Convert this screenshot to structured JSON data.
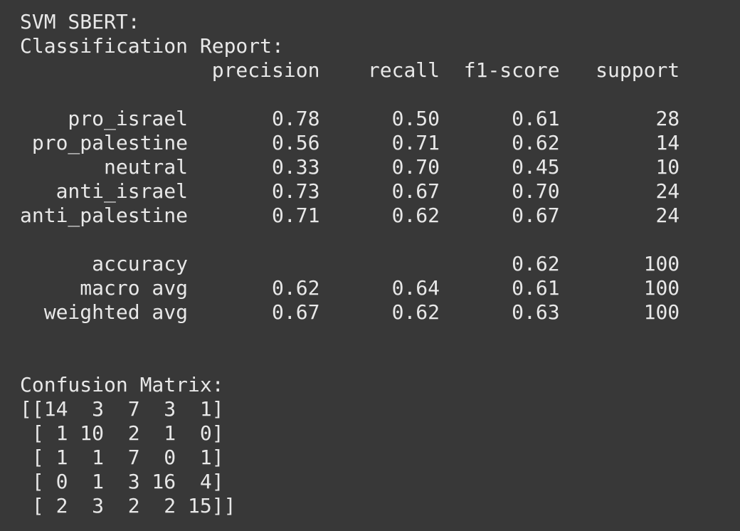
{
  "output": {
    "lines": [
      "SVM SBERT:",
      "Classification Report:",
      "                precision    recall  f1-score   support",
      "",
      "    pro_israel       0.78      0.50      0.61        28",
      " pro_palestine       0.56      0.71      0.62        14",
      "       neutral       0.33      0.70      0.45        10",
      "   anti_israel       0.73      0.67      0.70        24",
      "anti_palestine       0.71      0.62      0.67        24",
      "",
      "      accuracy                           0.62       100",
      "     macro avg       0.62      0.64      0.61       100",
      "  weighted avg       0.67      0.62      0.63       100",
      "",
      "",
      "Confusion Matrix:",
      "[[14  3  7  3  1]",
      " [ 1 10  2  1  0]",
      " [ 1  1  7  0  1]",
      " [ 0  1  3 16  4]",
      " [ 2  3  2  2 15]]"
    ]
  }
}
